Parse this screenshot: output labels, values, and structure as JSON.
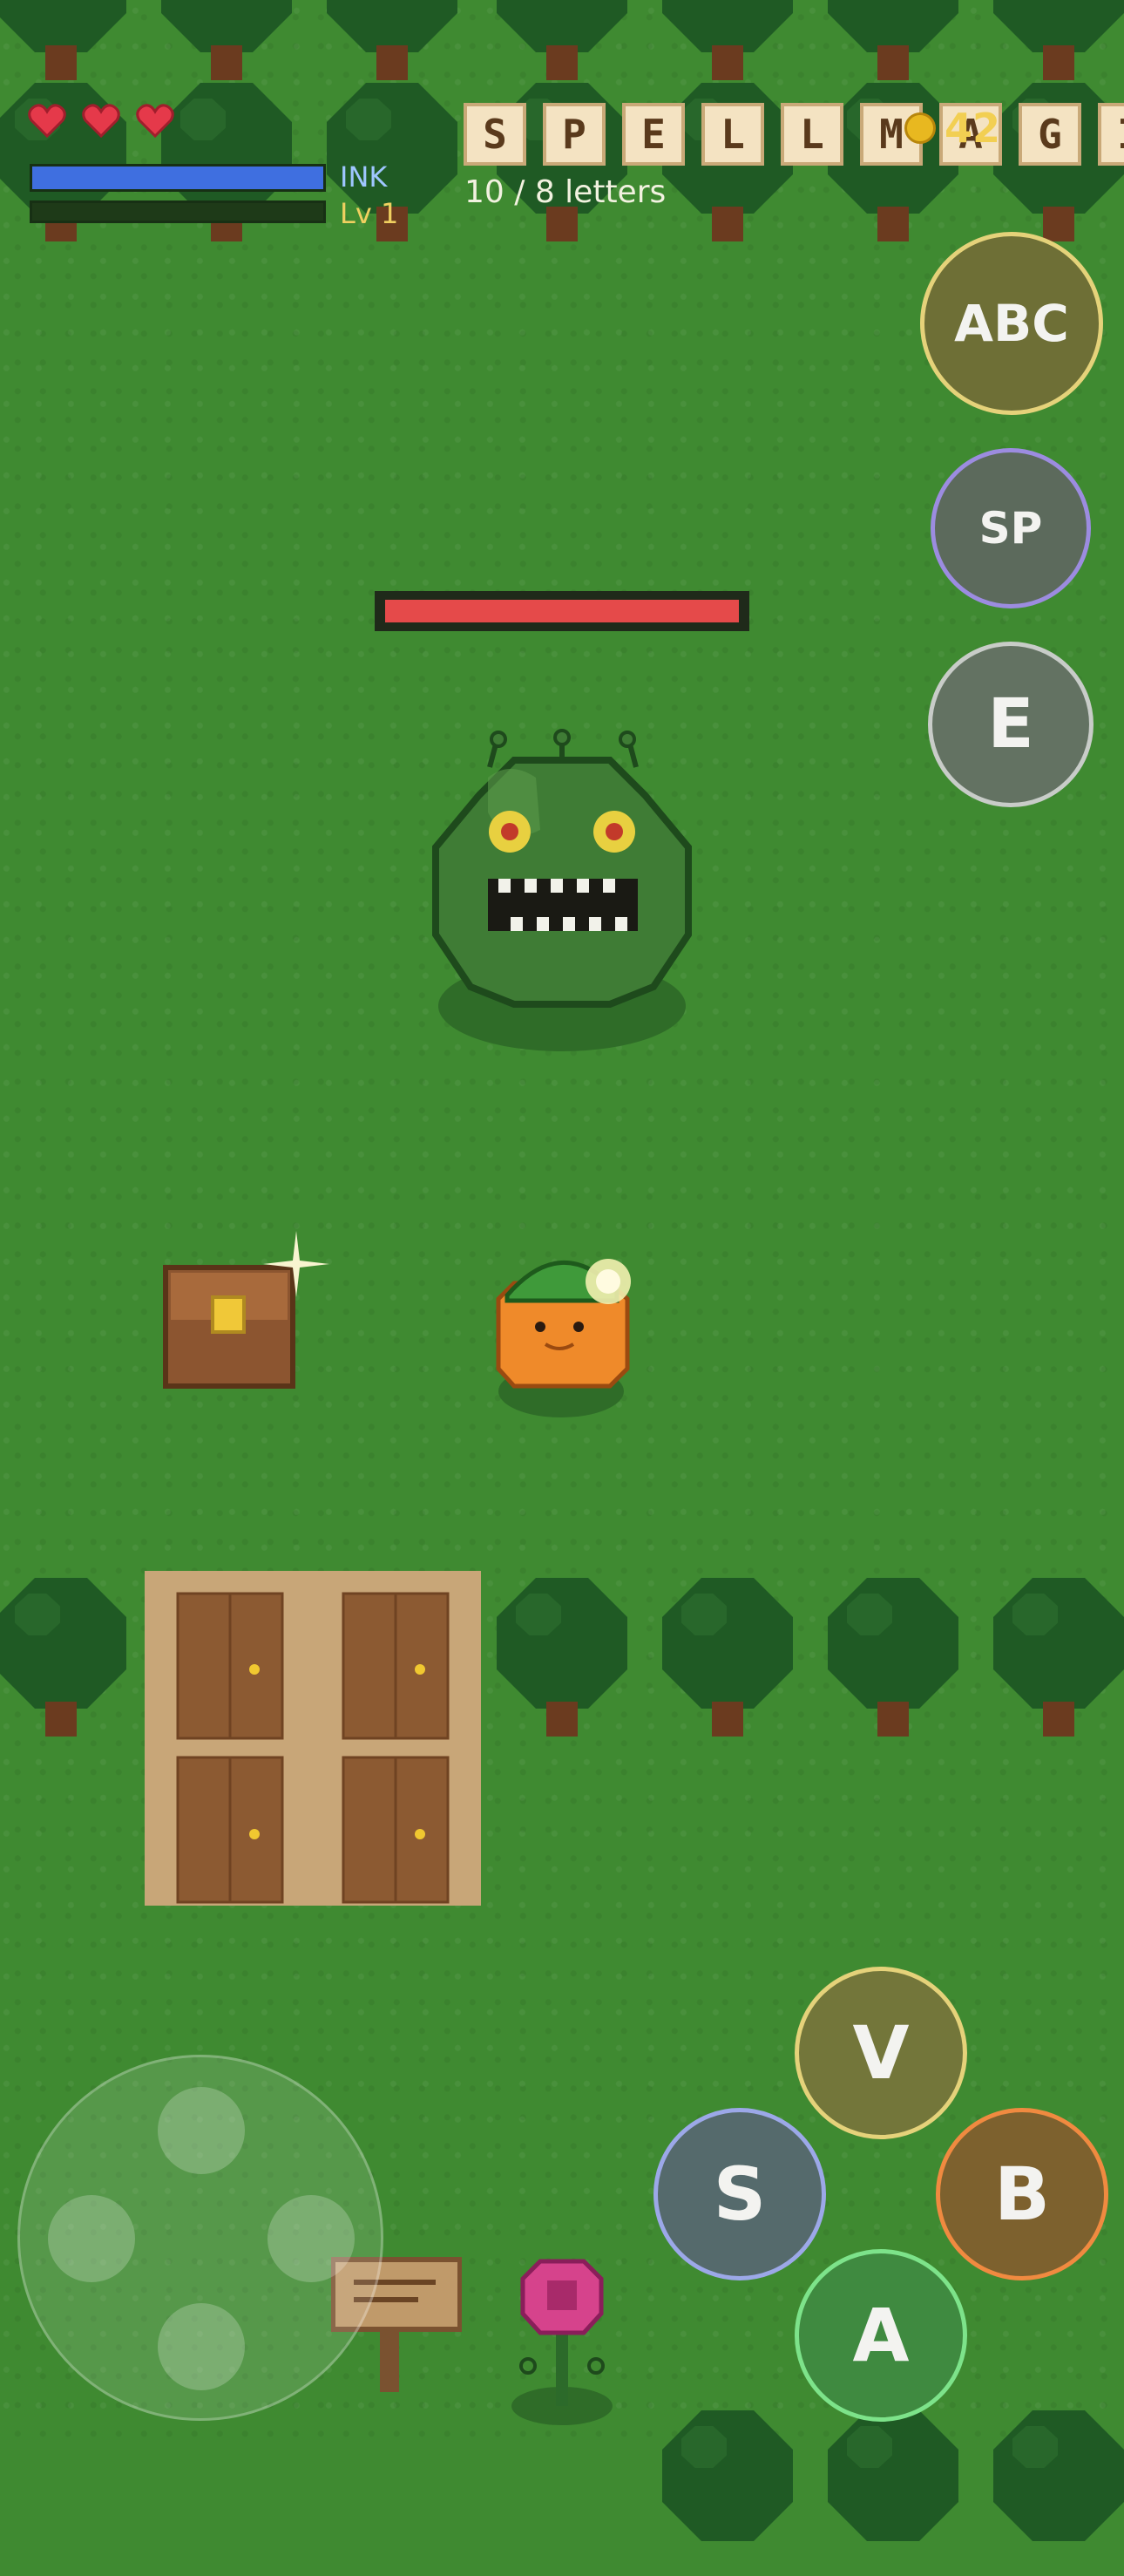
{
  "hud": {
    "hearts": 3,
    "ink_label": "INK",
    "ink_fill_fraction": 1.0,
    "level_label": "Lv 1",
    "xp_fill_fraction": 0.0,
    "word_tiles": [
      "S",
      "P",
      "E",
      "L",
      "L",
      "M",
      "A",
      "G",
      "I"
    ],
    "letters_count": "10 / 8 letters",
    "coin_count": "42"
  },
  "side_buttons": {
    "abc_label": "ABC",
    "sp_label": "SP",
    "e_label": "E"
  },
  "action_buttons": {
    "v_label": "V",
    "s_label": "S",
    "b_label": "B",
    "a_label": "A"
  },
  "boss": {
    "health_fraction": 1.0
  },
  "colors": {
    "grass": "#3f8a31",
    "ink_bar": "#3f6fe0",
    "health_bar": "#e54a4a",
    "level_text": "#f0d060",
    "ink_text": "#9fc6ff"
  }
}
